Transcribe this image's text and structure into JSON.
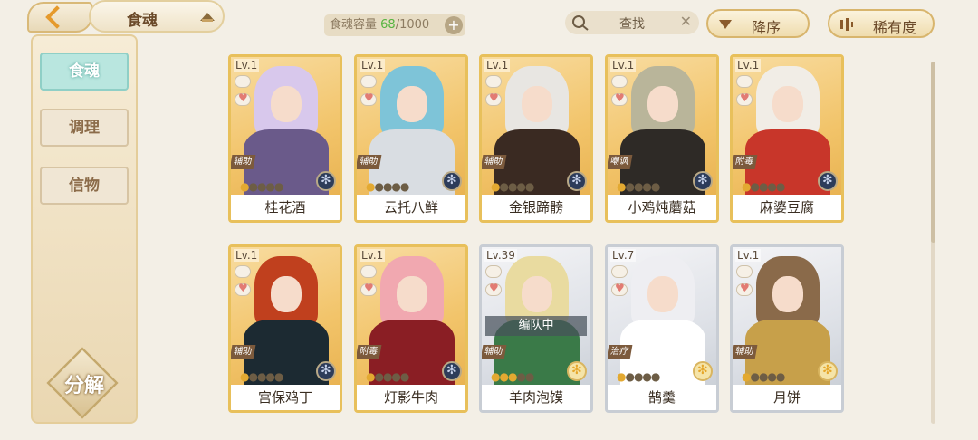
{
  "header": {
    "title": "食魂",
    "capacity_label": "食魂容量",
    "capacity_current": "68",
    "capacity_max": "/1000",
    "capacity_add": "+",
    "search_label": "查找",
    "search_clear": "✕",
    "sort_label": "降序",
    "rarity_label": "稀有度"
  },
  "sidebar": {
    "items": [
      {
        "label": "食魂"
      },
      {
        "label": "调理"
      },
      {
        "label": "信物"
      }
    ],
    "decompose_label": "分解"
  },
  "cards": [
    {
      "level": "Lv.1",
      "role": "辅助",
      "name": "桂花酒",
      "stars": "●●●●●",
      "gold_stars": 1,
      "rarity": "gold",
      "hair": "#d8c8ec",
      "outfit": "#6a5a8a"
    },
    {
      "level": "Lv.1",
      "role": "辅助",
      "name": "云托八鲜",
      "stars": "●●●●●",
      "gold_stars": 1,
      "rarity": "gold",
      "hair": "#7ec4d8",
      "outfit": "#d9dde2"
    },
    {
      "level": "Lv.1",
      "role": "辅助",
      "name": "金银蹄髈",
      "stars": "●●●●●",
      "gold_stars": 1,
      "rarity": "gold",
      "hair": "#e8e6e2",
      "outfit": "#3a2a22"
    },
    {
      "level": "Lv.1",
      "role": "嘲讽",
      "name": "小鸡炖蘑菇",
      "stars": "●●●●●",
      "gold_stars": 1,
      "rarity": "gold",
      "hair": "#b9b59a",
      "outfit": "#2e2a26"
    },
    {
      "level": "Lv.1",
      "role": "附毒",
      "name": "麻婆豆腐",
      "stars": "●●●●●",
      "gold_stars": 1,
      "rarity": "gold",
      "hair": "#f1ede6",
      "outfit": "#c8362a"
    },
    {
      "level": "Lv.1",
      "role": "辅助",
      "name": "宫保鸡丁",
      "stars": "●●●●●",
      "gold_stars": 1,
      "rarity": "gold",
      "hair": "#c0401e",
      "outfit": "#1c2a32"
    },
    {
      "level": "Lv.1",
      "role": "附毒",
      "name": "灯影牛肉",
      "stars": "●●●●●",
      "gold_stars": 1,
      "rarity": "gold",
      "hair": "#f1a8b0",
      "outfit": "#8a1e24"
    },
    {
      "level": "Lv.39",
      "role": "辅助",
      "name": "羊肉泡馍",
      "stars": "●●●●●",
      "gold_stars": 3,
      "rarity": "silver",
      "hair": "#e9dba0",
      "outfit": "#3a7a48",
      "team": "编队中"
    },
    {
      "level": "Lv.7",
      "role": "治疗",
      "name": "鹄羹",
      "stars": "●●●●●",
      "gold_stars": 1,
      "rarity": "silver",
      "hair": "#eeeef2",
      "outfit": "#ffffff"
    },
    {
      "level": "Lv.1",
      "role": "辅助",
      "name": "月饼",
      "stars": "●●●●●",
      "gold_stars": 1,
      "rarity": "silver",
      "hair": "#8a6a4a",
      "outfit": "#c7a04a"
    }
  ],
  "colors": {
    "gold_frame": "#e8c05b",
    "silver_frame": "#c8cdd4",
    "accent_teal": "#b9e6df",
    "capacity_green": "#55b43f"
  }
}
